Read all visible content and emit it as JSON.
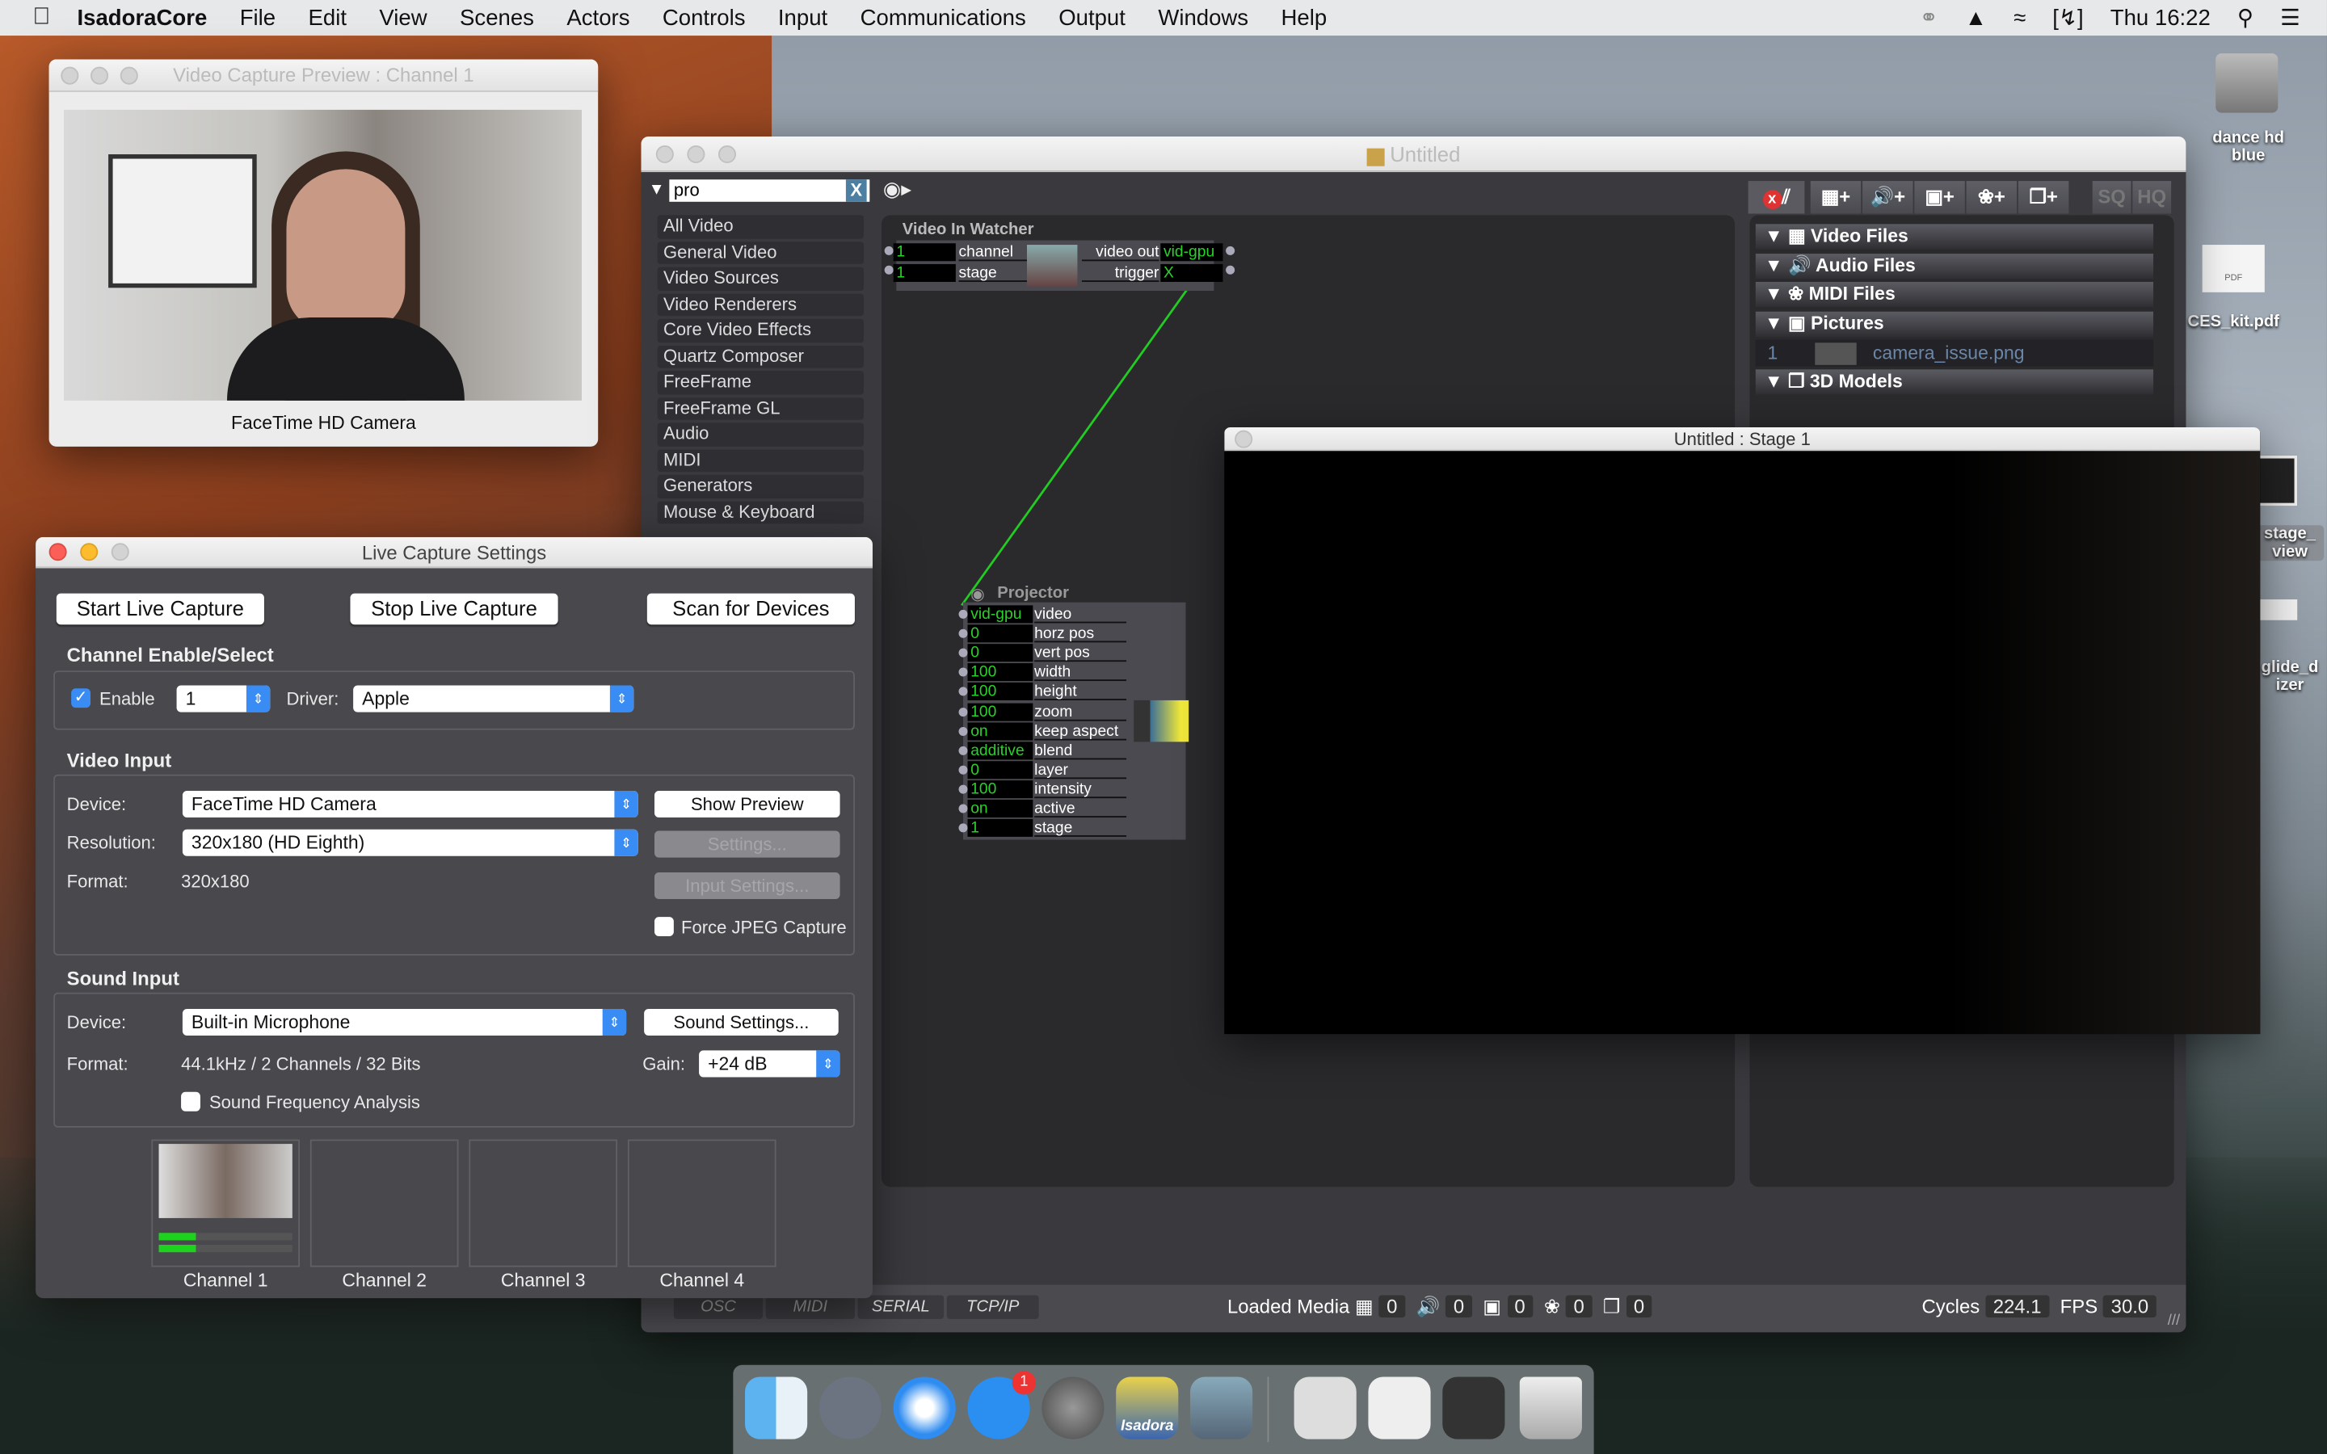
{
  "menubar": {
    "app": "IsadoraCore",
    "items": [
      "File",
      "Edit",
      "View",
      "Scenes",
      "Actors",
      "Controls",
      "Input",
      "Communications",
      "Output",
      "Windows",
      "Help"
    ],
    "clock": "Thu 16:22"
  },
  "preview": {
    "title": "Video Capture Preview : Channel 1",
    "caption": "FaceTime HD Camera"
  },
  "main": {
    "title": "Untitled",
    "search": "pro",
    "search_clear": "X",
    "categories": [
      "All Video",
      "General Video",
      "Video Sources",
      "Video Renderers",
      "Core Video Effects",
      "Quartz Composer",
      "FreeFrame",
      "FreeFrame GL",
      "Audio",
      "MIDI",
      "Generators",
      "Mouse & Keyboard"
    ],
    "watcher": {
      "title": "Video In Watcher",
      "inputs": [
        {
          "value": "1",
          "label": "channel"
        },
        {
          "value": "1",
          "label": "stage"
        }
      ],
      "outputs": [
        {
          "label": "video out",
          "value": "vid-gpu"
        },
        {
          "label": "trigger",
          "value": "X"
        }
      ]
    },
    "projector": {
      "title": "Projector",
      "inputs": [
        {
          "value": "vid-gpu",
          "label": "video"
        },
        {
          "value": "0",
          "label": "horz pos"
        },
        {
          "value": "0",
          "label": "vert pos"
        },
        {
          "value": "100",
          "label": "width"
        },
        {
          "value": "100",
          "label": "height"
        },
        {
          "value": "100",
          "label": "zoom"
        },
        {
          "value": "on",
          "label": "keep aspect"
        },
        {
          "value": "additive",
          "label": "blend"
        },
        {
          "value": "0",
          "label": "layer"
        },
        {
          "value": "100",
          "label": "intensity"
        },
        {
          "value": "on",
          "label": "active"
        },
        {
          "value": "1",
          "label": "stage"
        }
      ]
    },
    "media_toolbar": {
      "sq": "SQ",
      "hq": "HQ"
    },
    "media": {
      "sections": [
        "Video Files",
        "Audio Files",
        "MIDI Files",
        "Pictures",
        "3D Models"
      ],
      "picture": {
        "index": "1",
        "name": "camera_issue.png"
      }
    },
    "status": {
      "buttons": [
        "OSC",
        "MIDI",
        "SERIAL",
        "TCP/IP"
      ],
      "loaded_label": "Loaded Media",
      "counts": [
        "0",
        "0",
        "0",
        "0",
        "0"
      ],
      "cycles_label": "Cycles",
      "cycles": "224.1",
      "fps_label": "FPS",
      "fps": "30.0"
    }
  },
  "stage": {
    "title": "Untitled : Stage 1"
  },
  "live": {
    "title": "Live Capture Settings",
    "start": "Start Live Capture",
    "stop": "Stop Live Capture",
    "scan": "Scan for Devices",
    "channel_section": "Channel Enable/Select",
    "enable": "Enable",
    "enable_checked": true,
    "channel": "1",
    "driver_label": "Driver:",
    "driver": "Apple",
    "video_section": "Video Input",
    "device_label": "Device:",
    "device": "FaceTime HD Camera",
    "show_preview": "Show Preview",
    "resolution_label": "Resolution:",
    "resolution": "320x180 (HD Eighth)",
    "settings": "Settings...",
    "format_label": "Format:",
    "format": "320x180",
    "input_settings": "Input Settings...",
    "force_jpeg": "Force JPEG Capture",
    "sound_section": "Sound Input",
    "sound_device": "Built-in Microphone",
    "sound_settings": "Sound Settings...",
    "sound_format": "44.1kHz / 2 Channels / 32 Bits",
    "gain_label": "Gain:",
    "gain": "+24 dB",
    "freq": "Sound Frequency Analysis",
    "channels": [
      "Channel 1",
      "Channel 2",
      "Channel 3",
      "Channel 4"
    ]
  },
  "desktop": {
    "icons": [
      "dance hd blue",
      "CES_kit.pdf",
      "stage_ view",
      "glide_d izer"
    ],
    "pdf_badge": "PDF"
  },
  "dock": {
    "badge": "1",
    "isadora": "Isadora"
  },
  "colors": {
    "accent": "#3a8cf5",
    "port_value": "#2ad12a",
    "connection": "#22cc22"
  }
}
